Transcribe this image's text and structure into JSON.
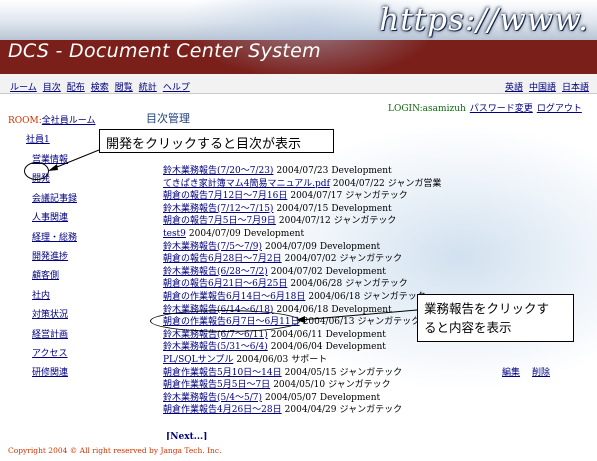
{
  "header": {
    "url_text": "https://www.",
    "title": "DCS - Document Center System"
  },
  "nav": {
    "left": [
      "ルーム",
      "目次",
      "配布",
      "検索",
      "閲覧",
      "統計",
      "ヘルプ"
    ],
    "right": [
      "英語",
      "中国語",
      "日本語"
    ]
  },
  "sidebar": {
    "room_label": "ROOM:",
    "room_link": "全社員ルーム",
    "user": "社員1",
    "items": [
      "営業情報",
      "開発",
      "会議記事録",
      "人事関連",
      "経理・総務",
      "開発進捗",
      "顧客側",
      "社内",
      "対策状況",
      "経営計画",
      "アクセス",
      "研修関連"
    ]
  },
  "main": {
    "title": "目次管理",
    "login_text": "LOGIN:asamizuh",
    "change_password": "パスワード変更",
    "logout": "ログアウト",
    "edit": "編集",
    "delete": "削除",
    "next": "[Next...]"
  },
  "documents": [
    {
      "title": "鈴木業務報告(7/20～7/23)",
      "date": "2004/07/23",
      "owner": "Development"
    },
    {
      "title": "てきぱき家計簿マム4簡易マニュアル.pdf",
      "date": "2004/07/22",
      "owner": "ジャンガ営業"
    },
    {
      "title": "朝倉の報告7月12日～7月16日",
      "date": "2004/07/17",
      "owner": "ジャンガテック"
    },
    {
      "title": "鈴木業務報告(7/12～7/15)",
      "date": "2004/07/15",
      "owner": "Development"
    },
    {
      "title": "朝倉の報告7月5日～7月9日",
      "date": "2004/07/12",
      "owner": "ジャンガテック"
    },
    {
      "title": "test9",
      "date": "2004/07/09",
      "owner": "Development"
    },
    {
      "title": "鈴木業務報告(7/5～7/9)",
      "date": "2004/07/09",
      "owner": "Development"
    },
    {
      "title": "朝倉の報告6月28日～7月2日",
      "date": "2004/07/02",
      "owner": "ジャンガテック"
    },
    {
      "title": "鈴木業務報告(6/28～7/2)",
      "date": "2004/07/02",
      "owner": "Development"
    },
    {
      "title": "朝倉の報告6月21日～6月25日",
      "date": "2004/06/28",
      "owner": "ジャンガテック"
    },
    {
      "title": "朝倉の作業報告6月14日～6月18日",
      "date": "2004/06/18",
      "owner": "ジャンガテック"
    },
    {
      "title": "鈴木業務報告(6/14～6/18)",
      "date": "2004/06/18",
      "owner": "Development"
    },
    {
      "title": "朝倉の作業報告6月7日～6月11日",
      "date": "2004/06/13",
      "owner": "ジャンガテック"
    },
    {
      "title": "鈴木業務報告(6/7～6/11)",
      "date": "2004/06/11",
      "owner": "Development"
    },
    {
      "title": "鈴木業務報告(5/31～6/4)",
      "date": "2004/06/04",
      "owner": "Development"
    },
    {
      "title": "PL/SQLサンプル",
      "date": "2004/06/03",
      "owner": "サポート"
    },
    {
      "title": "朝倉作業報告5月10日～14日",
      "date": "2004/05/15",
      "owner": "ジャンガテック"
    },
    {
      "title": "朝倉作業報告5月5日～7日",
      "date": "2004/05/10",
      "owner": "ジャンガテック"
    },
    {
      "title": "鈴木業務報告(5/4～5/7)",
      "date": "2004/05/07",
      "owner": "Development"
    },
    {
      "title": "朝倉作業報告4月26日～28日",
      "date": "2004/04/29",
      "owner": "ジャンガテック"
    }
  ],
  "callouts": {
    "first": "開発をクリックすると目次が表示",
    "second_line1": "業務報告をクリックす",
    "second_line2": "ると内容を表示"
  },
  "footer": {
    "copyright": "Copyright 2004 © All right reserved by Janga Tech. Inc."
  }
}
